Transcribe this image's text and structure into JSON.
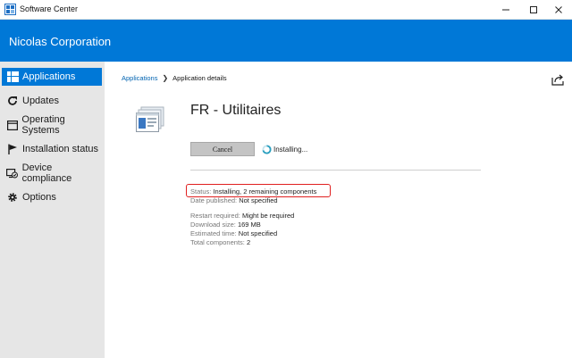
{
  "window": {
    "title": "Software Center",
    "controls": {
      "minimize": "minimize-icon",
      "maximize": "maximize-icon",
      "close": "close-icon"
    }
  },
  "banner": {
    "org_name": "Nicolas Corporation",
    "color": "#0078d7"
  },
  "sidebar": {
    "items": [
      {
        "label": "Applications",
        "icon": "applications-icon",
        "active": true
      },
      {
        "label": "Updates",
        "icon": "refresh-icon",
        "active": false
      },
      {
        "label": "Operating Systems",
        "icon": "window-icon",
        "active": false
      },
      {
        "label": "Installation status",
        "icon": "flag-icon",
        "active": false
      },
      {
        "label": "Device compliance",
        "icon": "compliance-icon",
        "active": false
      },
      {
        "label": "Options",
        "icon": "gear-icon",
        "active": false
      }
    ]
  },
  "breadcrumb": {
    "parent": "Applications",
    "current": "Application details"
  },
  "app": {
    "title": "FR - Utilitaires",
    "cancel_label": "Cancel",
    "state_text": "Installing..."
  },
  "details": {
    "status": {
      "key": "Status:",
      "value": "Installing, 2 remaining components"
    },
    "date_published": {
      "key": "Date published:",
      "value": "Not specified"
    },
    "restart_required": {
      "key": "Restart required:",
      "value": "Might be required"
    },
    "download_size": {
      "key": "Download size:",
      "value": "169 MB"
    },
    "estimated_time": {
      "key": "Estimated time:",
      "value": "Not specified"
    },
    "total_components": {
      "key": "Total components:",
      "value": "2"
    }
  },
  "colors": {
    "accent": "#0078d7",
    "sidebar_bg": "#e6e6e6",
    "highlight": "#e02020"
  }
}
